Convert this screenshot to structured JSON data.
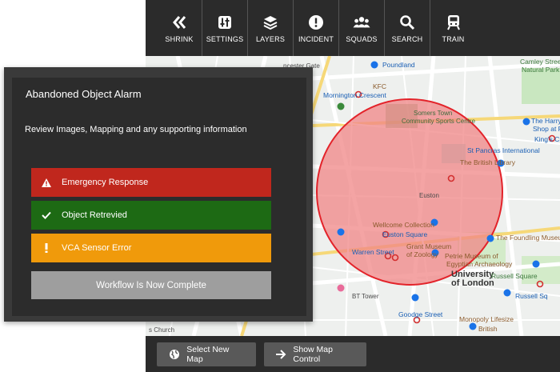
{
  "toolbar": {
    "items": [
      {
        "label": "SHRINK",
        "icon": "double-chevron-left-icon"
      },
      {
        "label": "SETTINGS",
        "icon": "sliders-icon"
      },
      {
        "label": "LAYERS",
        "icon": "layers-icon"
      },
      {
        "label": "INCIDENT",
        "icon": "alert-circle-icon"
      },
      {
        "label": "SQUADS",
        "icon": "people-icon"
      },
      {
        "label": "SEARCH",
        "icon": "search-icon"
      },
      {
        "label": "TRAIN",
        "icon": "train-icon"
      }
    ]
  },
  "panel": {
    "title": "Abandoned Object Alarm",
    "description": "Review Images, Mapping and any supporting information",
    "buttons": {
      "emergency": {
        "label": "Emergency Response",
        "color": "#c0271d",
        "icon": "warning-icon"
      },
      "retrieved": {
        "label": "Object Retrevied",
        "color": "#1d6a14",
        "icon": "check-icon"
      },
      "sensor": {
        "label": "VCA Sensor Error",
        "color": "#f09a0b",
        "icon": "exclamation-icon"
      },
      "complete": {
        "label": "Workflow Is Now Complete",
        "color": "#9e9e9e"
      }
    }
  },
  "bottombar": {
    "select_map": "Select New Map",
    "show_map_control": "Show Map Control"
  },
  "map": {
    "labels": {
      "poundland": "Poundland",
      "kfc": "KFC",
      "mornington": "Mornington Crescent",
      "somers_town": "Somers Town",
      "community": "Community Sports Centre",
      "camley": "Camley Street",
      "natural_park": "Natural Park",
      "harry_potter": "The Harry Potter",
      "shop": "Shop at Plat",
      "kings_cross": "King's Cro",
      "st_pancras": "St Pancras International",
      "british_library": "The British Library",
      "euston": "Euston",
      "wellcome": "Wellcome Collection",
      "euston_square": "Euston Square",
      "warren_street": "Warren Street",
      "grant_museum": "Grant Museum",
      "of_zoology": "of Zoology",
      "petrie": "Petrie Museum of",
      "egyptian": "Egyptian Archaeology",
      "university": "University",
      "of_london": "of London",
      "foundling": "The Foundling Museum",
      "russell_square": "Russell Square",
      "russell_sq": "Russell Sq",
      "goodge": "Goodge Street",
      "bt_tower": "BT Tower",
      "monopoly": "Monopoly Lifesize",
      "british": "British",
      "church": "s Church",
      "gate": "ncester Gate"
    }
  }
}
